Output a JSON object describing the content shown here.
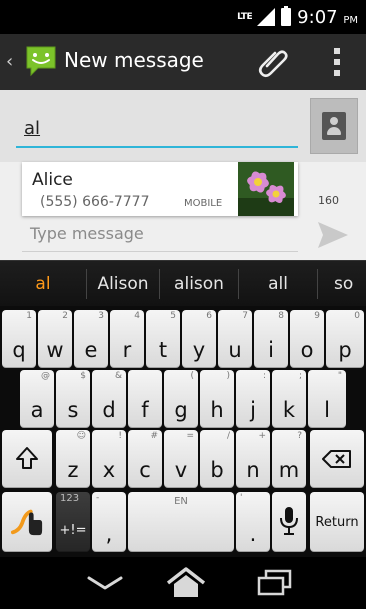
{
  "status_bar": {
    "network": "LTE",
    "time": "9:07",
    "ampm": "PM"
  },
  "action_bar": {
    "title": "New message",
    "icons": [
      "back-chevron-icon",
      "messaging-app-icon",
      "attach-paperclip-icon",
      "overflow-menu-icon"
    ]
  },
  "compose": {
    "to_value": "al",
    "suggestion": {
      "name": "Alice",
      "phone": "(555) 666-7777",
      "type": "MOBILE"
    },
    "char_count": "160",
    "message_placeholder": "Type message"
  },
  "keyboard": {
    "suggestions": [
      "al",
      "Alison",
      "alison",
      "all",
      "so"
    ],
    "row1": [
      {
        "k": "q",
        "a": "1"
      },
      {
        "k": "w",
        "a": "2"
      },
      {
        "k": "e",
        "a": "3"
      },
      {
        "k": "r",
        "a": "4"
      },
      {
        "k": "t",
        "a": "5"
      },
      {
        "k": "y",
        "a": "6"
      },
      {
        "k": "u",
        "a": "7"
      },
      {
        "k": "i",
        "a": "8"
      },
      {
        "k": "o",
        "a": "9"
      },
      {
        "k": "p",
        "a": "0"
      }
    ],
    "row2": [
      {
        "k": "a",
        "a": "@"
      },
      {
        "k": "s",
        "a": "$"
      },
      {
        "k": "d",
        "a": "&"
      },
      {
        "k": "f",
        "a": ""
      },
      {
        "k": "g",
        "a": "("
      },
      {
        "k": "h",
        "a": ")"
      },
      {
        "k": "j",
        "a": ":"
      },
      {
        "k": "k",
        "a": ";"
      },
      {
        "k": "l",
        "a": "\""
      }
    ],
    "row3": [
      {
        "k": "z",
        "a": "☺"
      },
      {
        "k": "x",
        "a": "!"
      },
      {
        "k": "c",
        "a": "#"
      },
      {
        "k": "v",
        "a": "="
      },
      {
        "k": "b",
        "a": "/"
      },
      {
        "k": "n",
        "a": "+"
      },
      {
        "k": "m",
        "a": "?"
      }
    ],
    "symbols_label_top": "123",
    "symbols_label_bottom": "+!=",
    "comma_key": ",",
    "comma_alt": "-",
    "space_label": "EN",
    "period_key": ".",
    "period_alt": "'",
    "return_label": "Return",
    "accent_color": "#ff9a1a"
  },
  "nav_bar": {
    "icons": [
      "back-icon",
      "home-icon",
      "recent-apps-icon"
    ]
  }
}
